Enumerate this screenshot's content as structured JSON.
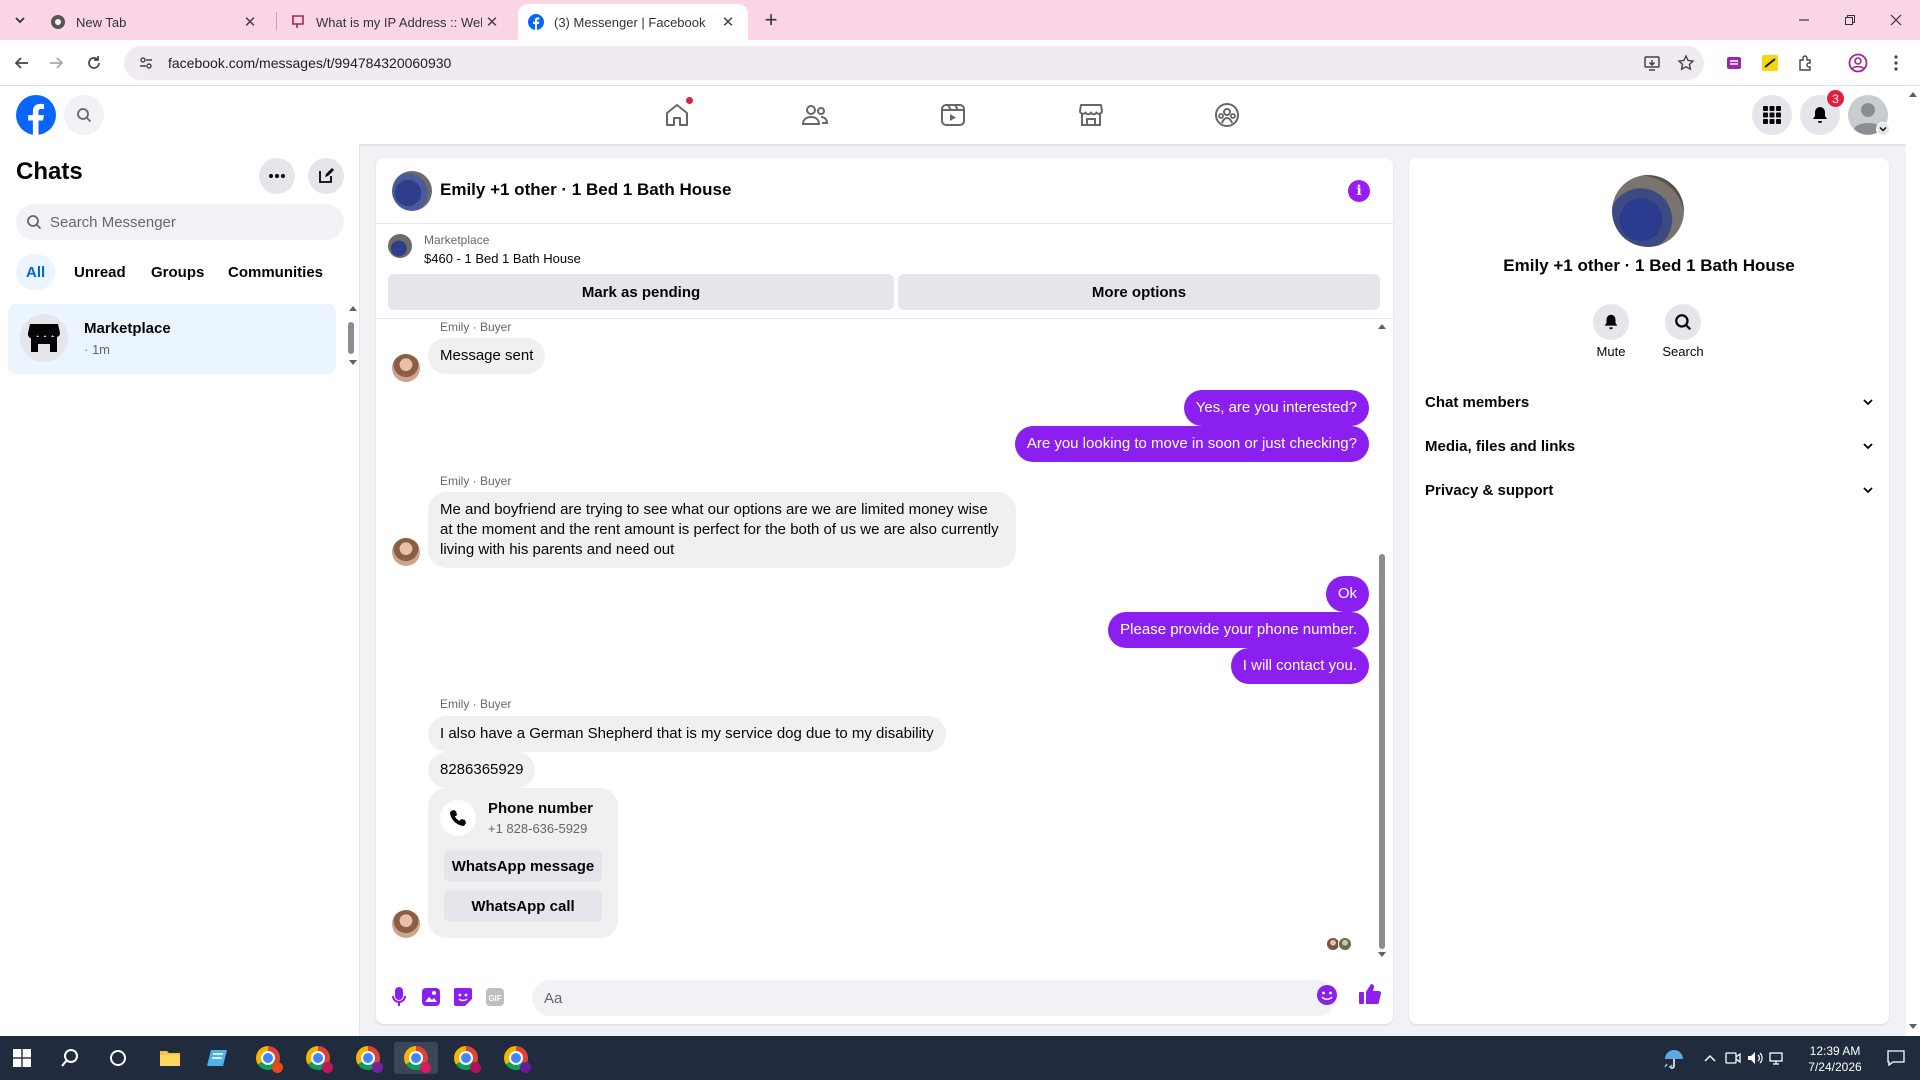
{
  "browser": {
    "tabs": [
      {
        "title": "New Tab"
      },
      {
        "title": "What is my IP Address :: WebBr"
      },
      {
        "title": "(3) Messenger | Facebook",
        "active": true
      }
    ],
    "url": "facebook.com/messages/t/994784320060930"
  },
  "fbnav": {
    "notifications_count": "3"
  },
  "chats": {
    "title": "Chats",
    "search_placeholder": "Search Messenger",
    "filters": [
      "All",
      "Unread",
      "Groups",
      "Communities"
    ],
    "items": [
      {
        "name": "Marketplace",
        "time": "· 1m"
      }
    ]
  },
  "conversation": {
    "title": "Emily +1 other · 1 Bed 1 Bath House",
    "marketplace_label": "Marketplace",
    "listing": "$460 - 1 Bed 1 Bath House",
    "mark_pending": "Mark as pending",
    "more_options": "More options",
    "sender_label": "Emily · Buyer",
    "messages": {
      "m1": "Message sent",
      "m2": "Yes, are you interested?",
      "m3": "Are you looking to move in soon or just checking?",
      "m4": "Me and boyfriend are trying to see what our options are we are limited money wise at the moment and the rent amount is perfect for the both of us we are also currently living with his parents and need out",
      "m5": "Ok",
      "m6": "Please provide your phone number.",
      "m7": "I will contact you.",
      "m8": "I also have a German Shepherd that is my service dog due to my disability",
      "m9": "8286365929"
    },
    "phone_card": {
      "label": "Phone number",
      "number": "+1 828-636-5929",
      "whatsapp_message": "WhatsApp message",
      "whatsapp_call": "WhatsApp call"
    },
    "input_placeholder": "Aa"
  },
  "info_panel": {
    "title": "Emily +1 other · 1 Bed 1 Bath House",
    "mute": "Mute",
    "search": "Search",
    "sections": [
      "Chat members",
      "Media, files and links",
      "Privacy & support"
    ]
  },
  "taskbar": {
    "time": "12:39 AM",
    "date": "7/24/2026"
  },
  "colors": {
    "brand": "#0866ff",
    "accent_bubble": "#8a1ff0",
    "tabbar": "#f9d5e6"
  }
}
